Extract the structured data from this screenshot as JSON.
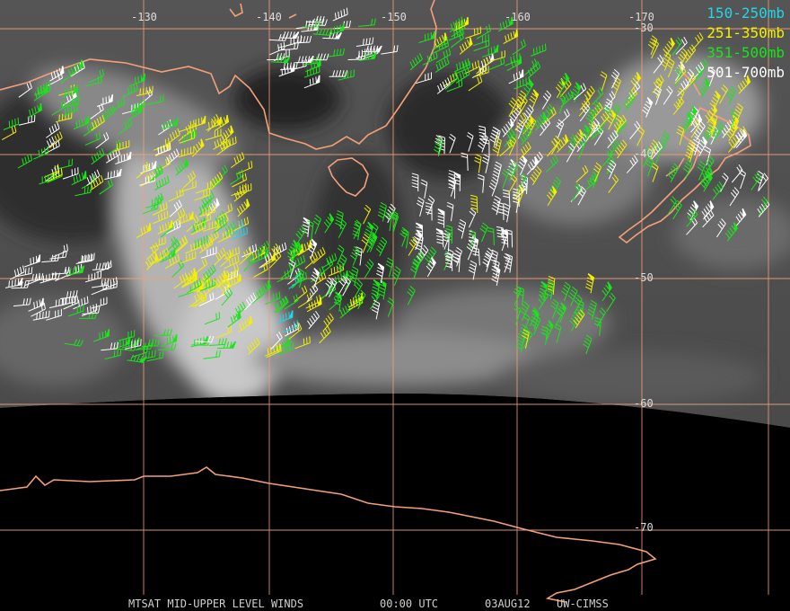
{
  "legend": [
    {
      "label": "150-250mb",
      "color": "#22d6e6"
    },
    {
      "label": "251-350mb",
      "color": "#f2f000"
    },
    {
      "label": "351-500mb",
      "color": "#19e619"
    },
    {
      "label": "501-700mb",
      "color": "#ffffff"
    }
  ],
  "longitude_labels": [
    "-130",
    "-140",
    "-150",
    "-160",
    "-170"
  ],
  "latitude_labels": [
    "-30",
    "-40",
    "-50",
    "-60",
    "-70"
  ],
  "footer": {
    "product": "MTSAT MID-UPPER LEVEL WINDS",
    "time": "00:00 UTC",
    "date": "03AUG12",
    "source": "UW-CIMSS"
  },
  "colors": {
    "grid": "#f4a07a",
    "coast": "#f4a07a",
    "background": "#000000"
  }
}
